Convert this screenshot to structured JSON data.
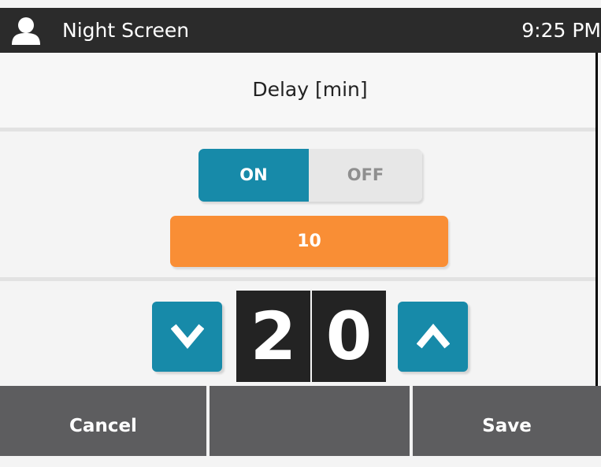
{
  "status_bar": {
    "title": "Night Screen",
    "time": "9:25 PM",
    "icon": "user-icon"
  },
  "setting": {
    "title": "Delay [min]"
  },
  "toggle": {
    "on_label": "ON",
    "off_label": "OFF",
    "selected": "ON"
  },
  "current_value": "10",
  "stepper": {
    "digits": [
      "2",
      "0"
    ],
    "decrease_icon": "chevron-down-icon",
    "increase_icon": "chevron-up-icon"
  },
  "footer": {
    "cancel_label": "Cancel",
    "middle_label": "",
    "save_label": "Save"
  },
  "colors": {
    "accent": "#178aa9",
    "value_bar": "#f98e35",
    "header_bar": "#2b2b2b",
    "footer": "#5d5d5f"
  }
}
